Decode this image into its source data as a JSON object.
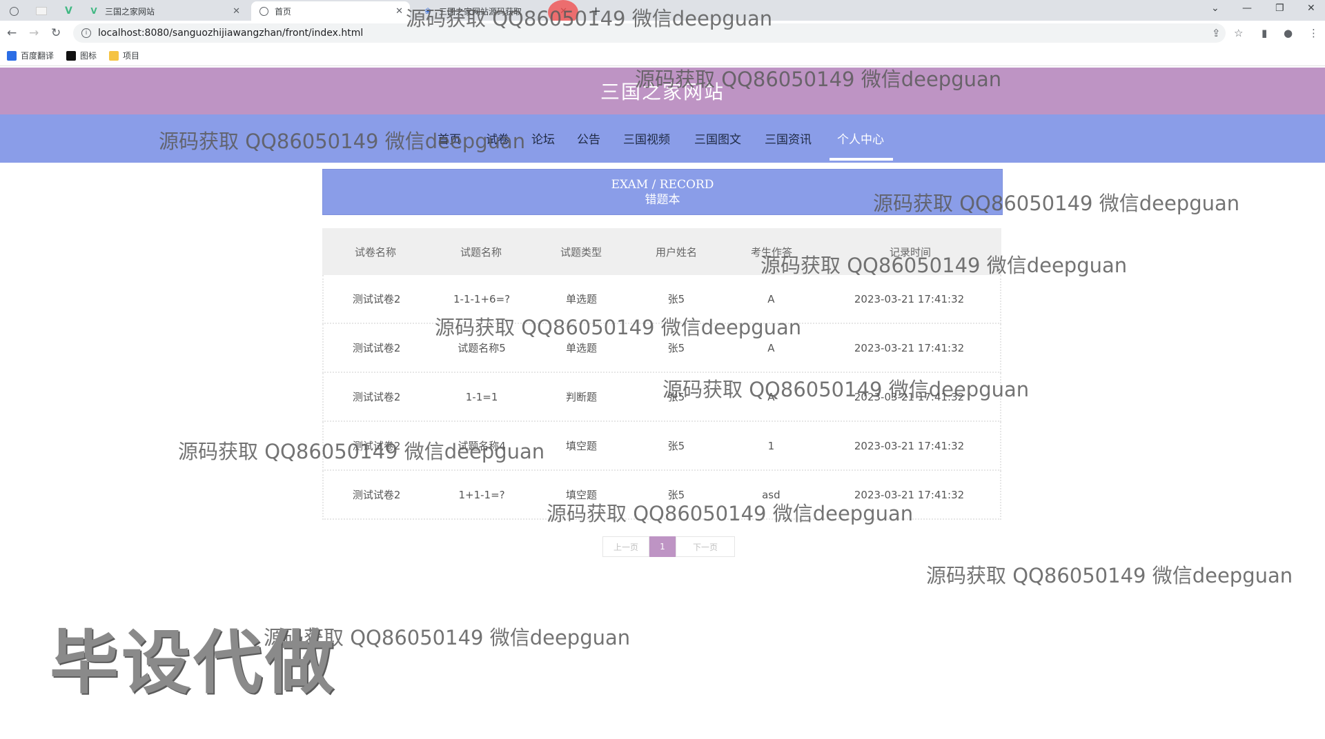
{
  "browser": {
    "tabs": [
      {
        "label": "三国之家网站",
        "active": false
      },
      {
        "label": "首页",
        "active": true
      },
      {
        "label": "三国之家网站源码获取",
        "active": false
      }
    ],
    "url": "localhost:8080/sanguozhijiawangzhan/front/index.html",
    "bookmarks": [
      "百度翻译",
      "图标",
      "项目"
    ]
  },
  "site": {
    "title": "三国之家网站",
    "nav": [
      "首页",
      "试卷",
      "论坛",
      "公告",
      "三国视频",
      "三国图文",
      "三国资讯",
      "个人中心"
    ],
    "active_nav": "个人中心"
  },
  "banner": {
    "en": "EXAM / RECORD",
    "zh": "错题本"
  },
  "table": {
    "headers": [
      "试卷名称",
      "试题名称",
      "试题类型",
      "用户姓名",
      "考生作答",
      "记录时间"
    ],
    "rows": [
      [
        "测试试卷2",
        "1-1-1+6=?",
        "单选题",
        "张5",
        "A",
        "2023-03-21 17:41:32"
      ],
      [
        "测试试卷2",
        "试题名称5",
        "单选题",
        "张5",
        "A",
        "2023-03-21 17:41:32"
      ],
      [
        "测试试卷2",
        "1-1=1",
        "判断题",
        "张5",
        "A",
        "2023-03-21 17:41:32"
      ],
      [
        "测试试卷2",
        "试题名称4",
        "填空题",
        "张5",
        "1",
        "2023-03-21 17:41:32"
      ],
      [
        "测试试卷2",
        "1+1-1=?",
        "填空题",
        "张5",
        "asd",
        "2023-03-21 17:41:32"
      ]
    ]
  },
  "pagination": {
    "prev": "上一页",
    "current": "1",
    "next": "下一页"
  },
  "overlay": {
    "watermark": "源码获取 QQ86050149 微信deepguan",
    "stamp": "毕设代做"
  },
  "colors": {
    "header": "#be94c4",
    "nav": "#8a9de8",
    "banner": "#8a9de8"
  }
}
